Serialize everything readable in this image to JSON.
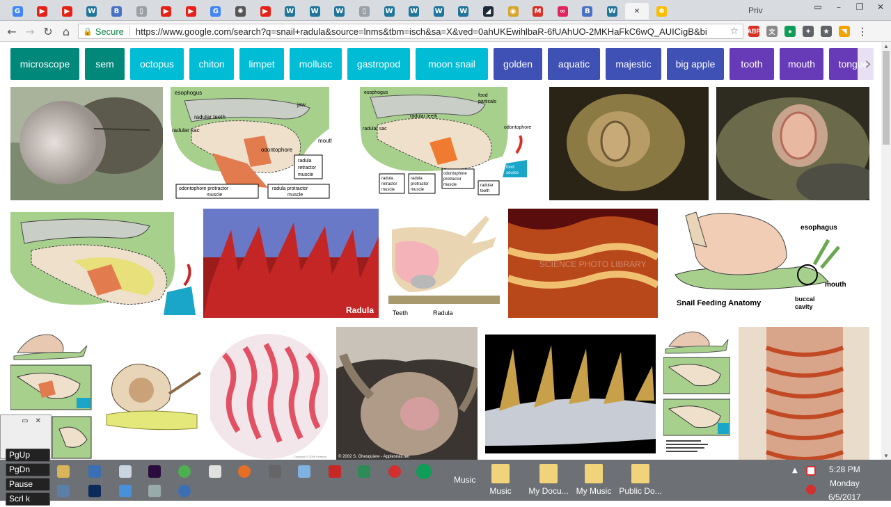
{
  "browser": {
    "tabs": [
      {
        "icon": "google-icon",
        "color": "#4285f4",
        "glyph": "G"
      },
      {
        "icon": "youtube-icon",
        "color": "#e62117",
        "glyph": "▶"
      },
      {
        "icon": "youtube-icon",
        "color": "#e62117",
        "glyph": "▶"
      },
      {
        "icon": "wordpress-icon",
        "color": "#21759b",
        "glyph": "W"
      },
      {
        "icon": "blogger-icon",
        "color": "#4a72c4",
        "glyph": "B"
      },
      {
        "icon": "document-icon",
        "color": "#9aa0a6",
        "glyph": "▯"
      },
      {
        "icon": "youtube-icon",
        "color": "#e62117",
        "glyph": "▶"
      },
      {
        "icon": "youtube-icon",
        "color": "#e62117",
        "glyph": "▶"
      },
      {
        "icon": "google-icon",
        "color": "#4285f4",
        "glyph": "G"
      },
      {
        "icon": "dotted-wheel-icon",
        "color": "#555555",
        "glyph": "✺"
      },
      {
        "icon": "youtube-icon",
        "color": "#e62117",
        "glyph": "▶"
      },
      {
        "icon": "wordpress-icon",
        "color": "#21759b",
        "glyph": "W"
      },
      {
        "icon": "wordpress-icon",
        "color": "#21759b",
        "glyph": "W"
      },
      {
        "icon": "wordpress-icon",
        "color": "#21759b",
        "glyph": "W"
      },
      {
        "icon": "document-icon",
        "color": "#9aa0a6",
        "glyph": "▯"
      },
      {
        "icon": "wordpress-icon",
        "color": "#21759b",
        "glyph": "W"
      },
      {
        "icon": "wordpress-icon",
        "color": "#21759b",
        "glyph": "W"
      },
      {
        "icon": "wordpress-icon",
        "color": "#21759b",
        "glyph": "W"
      },
      {
        "icon": "wordpress-icon",
        "color": "#21759b",
        "glyph": "W"
      },
      {
        "icon": "dark-app-icon",
        "color": "#1d2a3a",
        "glyph": "◢"
      },
      {
        "icon": "coin-icon",
        "color": "#d4a72c",
        "glyph": "◉"
      },
      {
        "icon": "gmail-icon",
        "color": "#d93025",
        "glyph": "M"
      },
      {
        "icon": "link-icon",
        "color": "#e0245e",
        "glyph": "∞"
      },
      {
        "icon": "blogger-icon",
        "color": "#4a72c4",
        "glyph": "B"
      },
      {
        "icon": "wordpress-icon",
        "color": "#21759b",
        "glyph": "W"
      },
      {
        "icon": "close-tab-icon",
        "color": "#f4f4f5",
        "glyph": "✕"
      },
      {
        "icon": "google-photos-icon",
        "color": "#fbbc04",
        "glyph": "✽"
      }
    ],
    "last_tab_label": "Priv",
    "secure_label": "Secure",
    "url": "https://www.google.com/search?q=snail+radula&source=lnms&tbm=isch&sa=X&ved=0ahUKEwihlbaR-6fUAhUO-2MKHaFkC6wQ_AUICigB&biw=",
    "extensions": [
      {
        "icon": "adblock-icon",
        "color": "#d93025",
        "glyph": "ABP"
      },
      {
        "icon": "translate-icon",
        "color": "#8a8a8a",
        "glyph": "文"
      },
      {
        "icon": "hangouts-icon",
        "color": "#0f9d58",
        "glyph": "●"
      },
      {
        "icon": "tool-icon",
        "color": "#5f6368",
        "glyph": "✦"
      },
      {
        "icon": "star-badge-icon",
        "color": "#5f6368",
        "glyph": "★"
      },
      {
        "icon": "rss-icon",
        "color": "#f4a300",
        "glyph": "◥"
      },
      {
        "icon": "menu-icon",
        "color": "#5f6368",
        "glyph": "⋮"
      }
    ]
  },
  "chips": [
    {
      "label": "microscope",
      "color": "#00897b"
    },
    {
      "label": "sem",
      "color": "#00897b"
    },
    {
      "label": "octopus",
      "color": "#00bcd4"
    },
    {
      "label": "chiton",
      "color": "#00bcd4"
    },
    {
      "label": "limpet",
      "color": "#00bcd4"
    },
    {
      "label": "mollusc",
      "color": "#00bcd4"
    },
    {
      "label": "gastropod",
      "color": "#00bcd4"
    },
    {
      "label": "moon snail",
      "color": "#00bcd4"
    },
    {
      "label": "golden",
      "color": "#3f51b5"
    },
    {
      "label": "aquatic",
      "color": "#3f51b5"
    },
    {
      "label": "majestic",
      "color": "#3f51b5"
    },
    {
      "label": "big apple",
      "color": "#3f51b5"
    },
    {
      "label": "tooth",
      "color": "#673ab7"
    },
    {
      "label": "mouth",
      "color": "#673ab7"
    },
    {
      "label": "tongue",
      "color": "#673ab7"
    }
  ],
  "diagram1": {
    "esophogus": "esophogus",
    "jaw": "jaw",
    "radular_teeth": "radular teeth",
    "radular_sac": "radular sac",
    "mouth": "mouth",
    "odontophore": "odontophore",
    "radula_retractor": [
      "radula",
      "retractor",
      "muscle"
    ],
    "odontophore_protractor": [
      "odontophore protractor",
      "muscle"
    ],
    "radula_protractor": [
      "radula protractor",
      "muscle"
    ]
  },
  "diagram2": {
    "esophogus": "esophogus",
    "food_particals": [
      "food",
      "particals"
    ],
    "radular_teeth": "radular teeth",
    "radular_sac": "radular sac",
    "odontophore": "odontophore",
    "radula_retractor": [
      "radula",
      "retractor",
      "muscle"
    ],
    "radula_protractor": [
      "radula",
      "protractor",
      "muscle"
    ],
    "odontophore_protractor": [
      "odontophore",
      "protractor",
      "muscle"
    ],
    "radular_teeth_box": [
      "radular",
      "teeth"
    ],
    "food_source": [
      "food",
      "source"
    ]
  },
  "radula_caption": "Radula",
  "teeth_caption": "Teeth",
  "radula2_caption": "Radula",
  "watermark": "SCIENCE PHOTO LIBRARY",
  "snail_anatomy": {
    "title": "Snail Feeding Anatomy",
    "esophagus": "esophagus",
    "mouth": "mouth",
    "buccal_cavity": [
      "buccal",
      "cavity"
    ]
  },
  "copyright": "© 2002 S. Ghesquiere - Applesnail.net",
  "copyright2": "Copyright © 2009 Pearson",
  "virtual_keys": [
    "PgUp",
    "PgDn",
    "Pause",
    "Scrl k"
  ],
  "taskbar": {
    "music_label": "Music",
    "folders": [
      "Music",
      "My Docu...",
      "My Music",
      "Public Do..."
    ],
    "time": "5:28 PM",
    "day": "Monday",
    "date": "6/5/2017"
  }
}
